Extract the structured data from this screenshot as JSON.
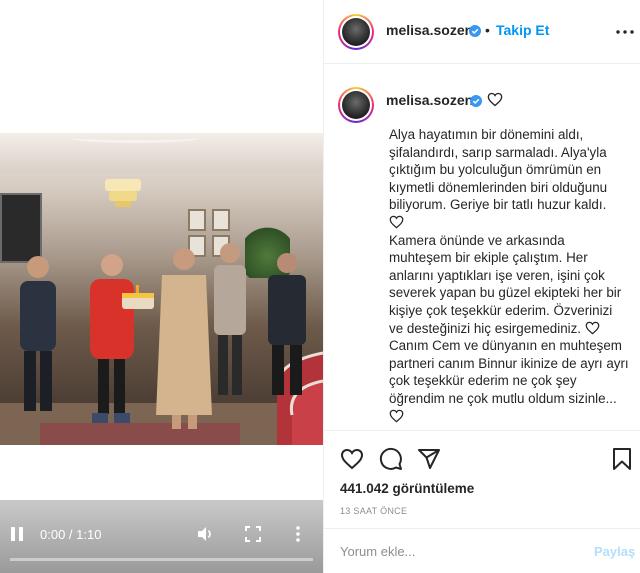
{
  "video": {
    "time": "0:00 / 1:10",
    "progress_fraction": 0.0
  },
  "header": {
    "username": "melisa.sozen",
    "separator": "•",
    "follow_label": "Takip Et",
    "more_icon": "more-horizontal-icon"
  },
  "caption": {
    "username": "melisa.sozen",
    "paragraphs": [
      "Alya hayatımın bir dönemini aldı, şifalandırdı, sarıp sarmaladı. Alya'yla çıktığım bu yolculuğun ömrümün en kıymetli dönemlerinden biri olduğunu biliyorum. Geriye bir tatlı huzur kaldı.",
      "Kamera önünde ve arkasında muhteşem bir ekiple çalıştım. Her anlarını yaptıkları işe veren, işini çok severek yapan bu güzel ekipteki her bir kişiye çok teşekkür ederim. Özverinizi ve desteğinizi hiç esirgemediniz.",
      "Canım Cem ve dünyanın en muhteşem partneri canım Binnur ikinize de ayrı ayrı çok teşekkür ederim ne çok şey öğrendim ne çok mutlu oldum sizinle..."
    ]
  },
  "actions": {
    "views": "441.042 görüntüleme",
    "timestamp": "13 SAAT ÖNCE"
  },
  "comment": {
    "placeholder": "Yorum ekle...",
    "share_label": "Paylaş"
  },
  "colors": {
    "accent": "#0095f6",
    "verified": "#3897f0",
    "share_disabled": "#b2dffc"
  }
}
